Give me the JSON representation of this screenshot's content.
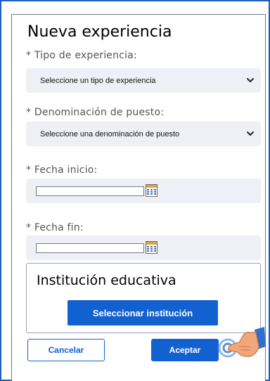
{
  "form": {
    "title": "Nueva experiencia",
    "tipo_label": "* Tipo de experiencia:",
    "tipo_value": "Seleccione un tipo de experiencia",
    "puesto_label": "* Denominación de puesto:",
    "puesto_value": "Seleccione una denominación de puesto",
    "inicio_label": "* Fecha inicio:",
    "inicio_value": "",
    "fin_label": "* Fecha fin:",
    "fin_value": ""
  },
  "institucion": {
    "title": "Institución educativa",
    "button_label": "Seleccionar institución"
  },
  "actions": {
    "cancel_label": "Cancelar",
    "accept_label": "Aceptar"
  },
  "icons": {
    "select_chevron": "chevron-down-icon",
    "calendar": "calendar-icon",
    "pointer": "pointing-hand-icon"
  },
  "colors": {
    "primary": "#1261d1",
    "field_bg": "#eef0f6",
    "frame": "#1f5fb8"
  }
}
